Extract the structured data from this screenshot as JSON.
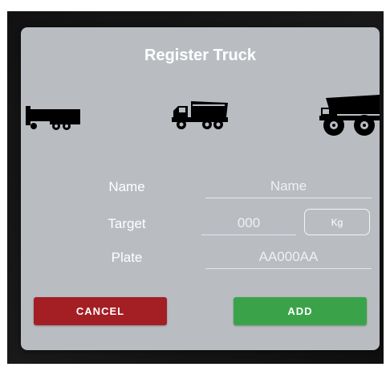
{
  "dialog": {
    "title": "Register Truck"
  },
  "truck_types": [
    {
      "icon": "semi-trailer-truck-icon"
    },
    {
      "icon": "dump-truck-icon"
    },
    {
      "icon": "mining-haul-truck-icon"
    }
  ],
  "form": {
    "name": {
      "label": "Name",
      "placeholder": "Name"
    },
    "target": {
      "label": "Target",
      "placeholder": "000",
      "unit": "Kg"
    },
    "plate": {
      "label": "Plate",
      "placeholder": "AA000AA"
    }
  },
  "actions": {
    "cancel_label": "CANCEL",
    "add_label": "ADD"
  },
  "colors": {
    "dialog_bg": "#b9bdc2",
    "cancel": "#a31f24",
    "add": "#3aa34a",
    "text": "#ffffff"
  }
}
